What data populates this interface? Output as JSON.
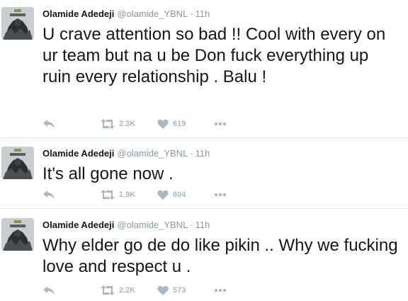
{
  "tweets": [
    {
      "name": "Olamide Adedeji",
      "handle": "@olamide_YBNL",
      "dot": "·",
      "time": "11h",
      "text": "U crave attention so bad !! Cool with every on ur team but na u be Don fuck everything up ruin every relationship . Balu !",
      "retweets": "2.3K",
      "likes": "619"
    },
    {
      "name": "Olamide Adedeji",
      "handle": "@olamide_YBNL",
      "dot": "·",
      "time": "11h",
      "text": "It's all gone now .",
      "retweets": "1.9K",
      "likes": "604"
    },
    {
      "name": "Olamide Adedeji",
      "handle": "@olamide_YBNL",
      "dot": "·",
      "time": "11h",
      "text": "Why elder go de do like pikin .. Why we fucking love and respect u .",
      "retweets": "2.2K",
      "likes": "573"
    }
  ],
  "icons": {
    "reply": "reply-icon",
    "retweet": "retweet-icon",
    "like": "heart-icon",
    "more": "more-icon"
  },
  "colors": {
    "text": "#14171a",
    "muted": "#8899a6",
    "action": "#aab8c2",
    "divider": "#e1e8ed"
  }
}
